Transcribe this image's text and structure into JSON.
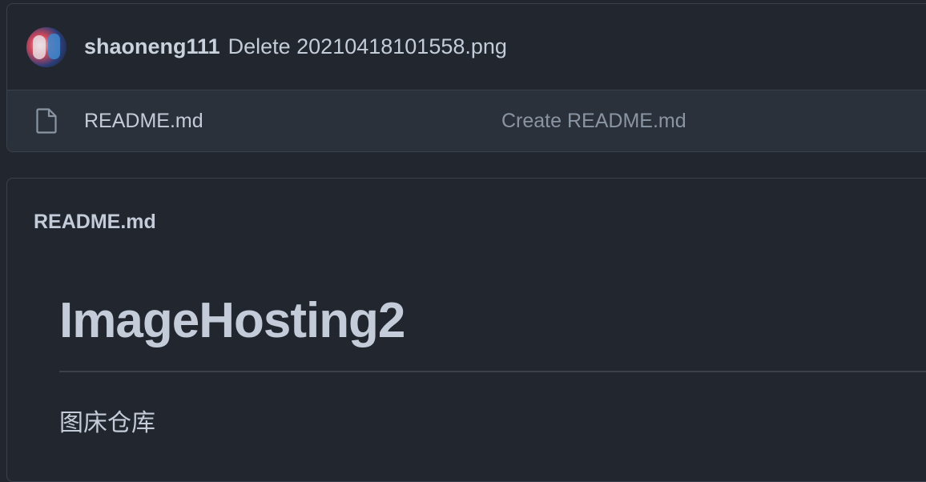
{
  "latest_commit": {
    "author": "shaoneng111",
    "message": "Delete 20210418101558.png"
  },
  "files": [
    {
      "icon": "file-icon",
      "name": "README.md",
      "commit_message": "Create README.md"
    }
  ],
  "readme": {
    "filename": "README.md",
    "title": "ImageHosting2",
    "description": "图床仓库"
  },
  "colors": {
    "background": "#22262e",
    "border": "#3a414c",
    "row_background": "#2b313a",
    "text": "#c3ccd8",
    "muted_text": "#8a95a3"
  }
}
